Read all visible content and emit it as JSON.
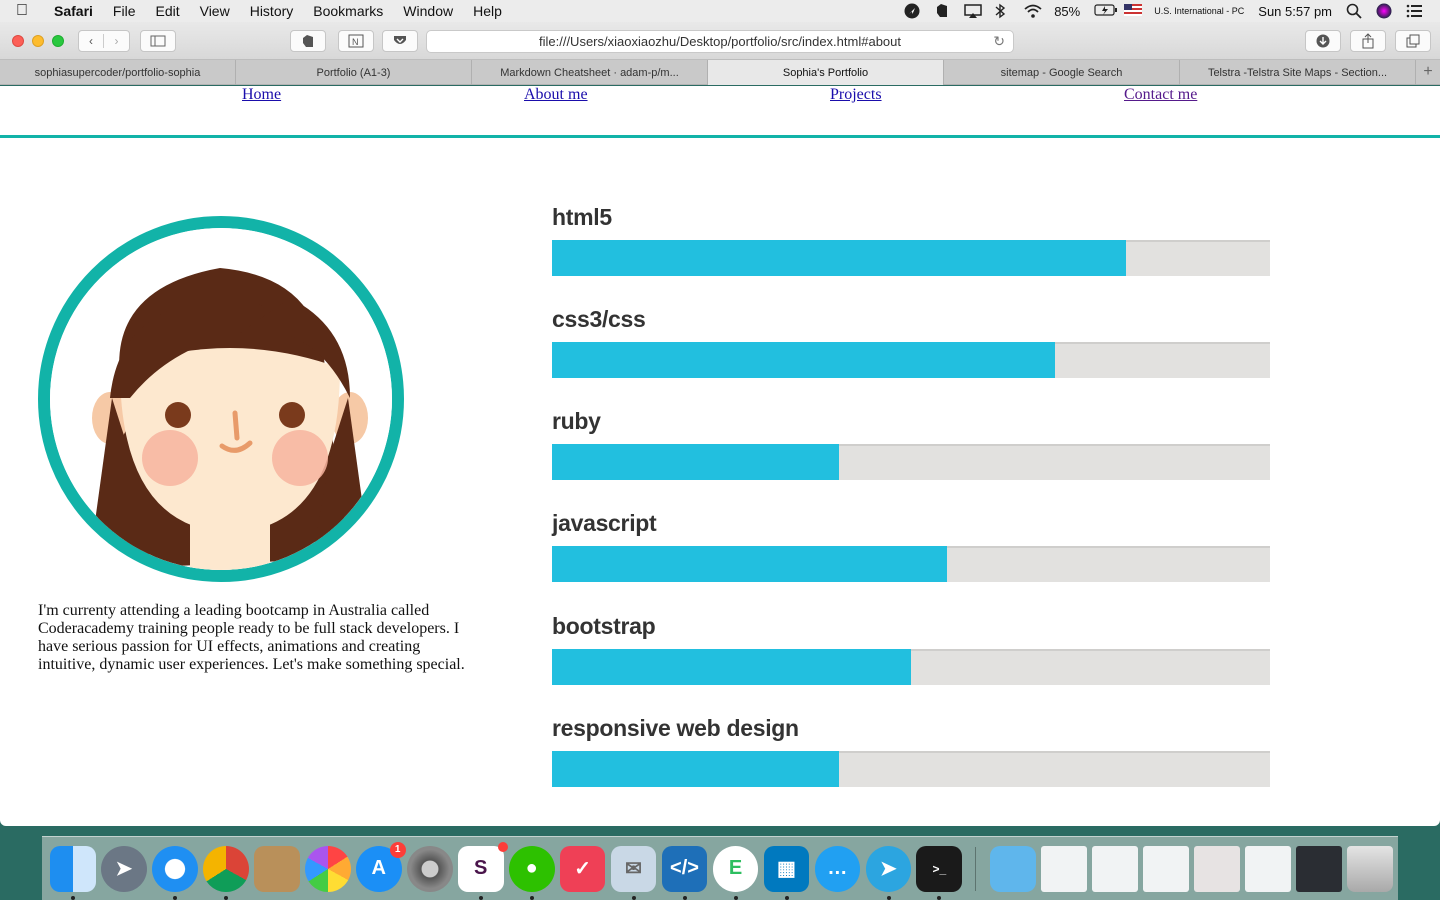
{
  "menubar": {
    "app": "Safari",
    "items": [
      "File",
      "Edit",
      "View",
      "History",
      "Bookmarks",
      "Window",
      "Help"
    ],
    "battery": "85%",
    "input_source": "U.S. International - PC",
    "clock": "Sun 5:57 pm"
  },
  "toolbar": {
    "url": "file:///Users/xiaoxiaozhu/Desktop/portfolio/src/index.html#about"
  },
  "tabs": [
    {
      "title": "sophiasupercoder/portfolio-sophia",
      "active": false
    },
    {
      "title": "Portfolio (A1-3)",
      "active": false
    },
    {
      "title": "Markdown Cheatsheet · adam-p/m...",
      "active": false
    },
    {
      "title": "Sophia's Portfolio",
      "active": true
    },
    {
      "title": "sitemap - Google Search",
      "active": false
    },
    {
      "title": "Telstra -Telstra Site Maps - Section...",
      "active": false
    }
  ],
  "nav": {
    "home": "Home",
    "about": "About me",
    "projects": "Projects",
    "contact": "Contact me"
  },
  "about": {
    "bio": "I'm currenty attending a leading bootcamp in Australia called Coderacademy training people ready to be full stack developers. I have serious passion for UI effects, animations and creating intuitive, dynamic user experiences. Let's make something special."
  },
  "skills": [
    {
      "name": "html5",
      "level": 0.8
    },
    {
      "name": "css3/css",
      "level": 0.7
    },
    {
      "name": "ruby",
      "level": 0.4
    },
    {
      "name": "javascript",
      "level": 0.55
    },
    {
      "name": "bootstrap",
      "level": 0.5
    },
    {
      "name": "responsive web design",
      "level": 0.4
    }
  ],
  "colors": {
    "accent": "#12b3a8",
    "bar_fill": "#22bfdf",
    "bar_track": "#e2e1df"
  },
  "dock": {
    "items": [
      "finder-icon",
      "launchpad-icon",
      "safari-icon",
      "chrome-icon",
      "contacts-icon",
      "photos-icon",
      "app-store-icon",
      "system-preferences-icon",
      "slack-icon",
      "wechat-icon",
      "pocket-icon",
      "preview-icon",
      "vscode-icon",
      "evernote-icon",
      "trello-icon",
      "messages-icon",
      "telegram-icon",
      "terminal-icon"
    ],
    "app_store_badge": "1"
  }
}
